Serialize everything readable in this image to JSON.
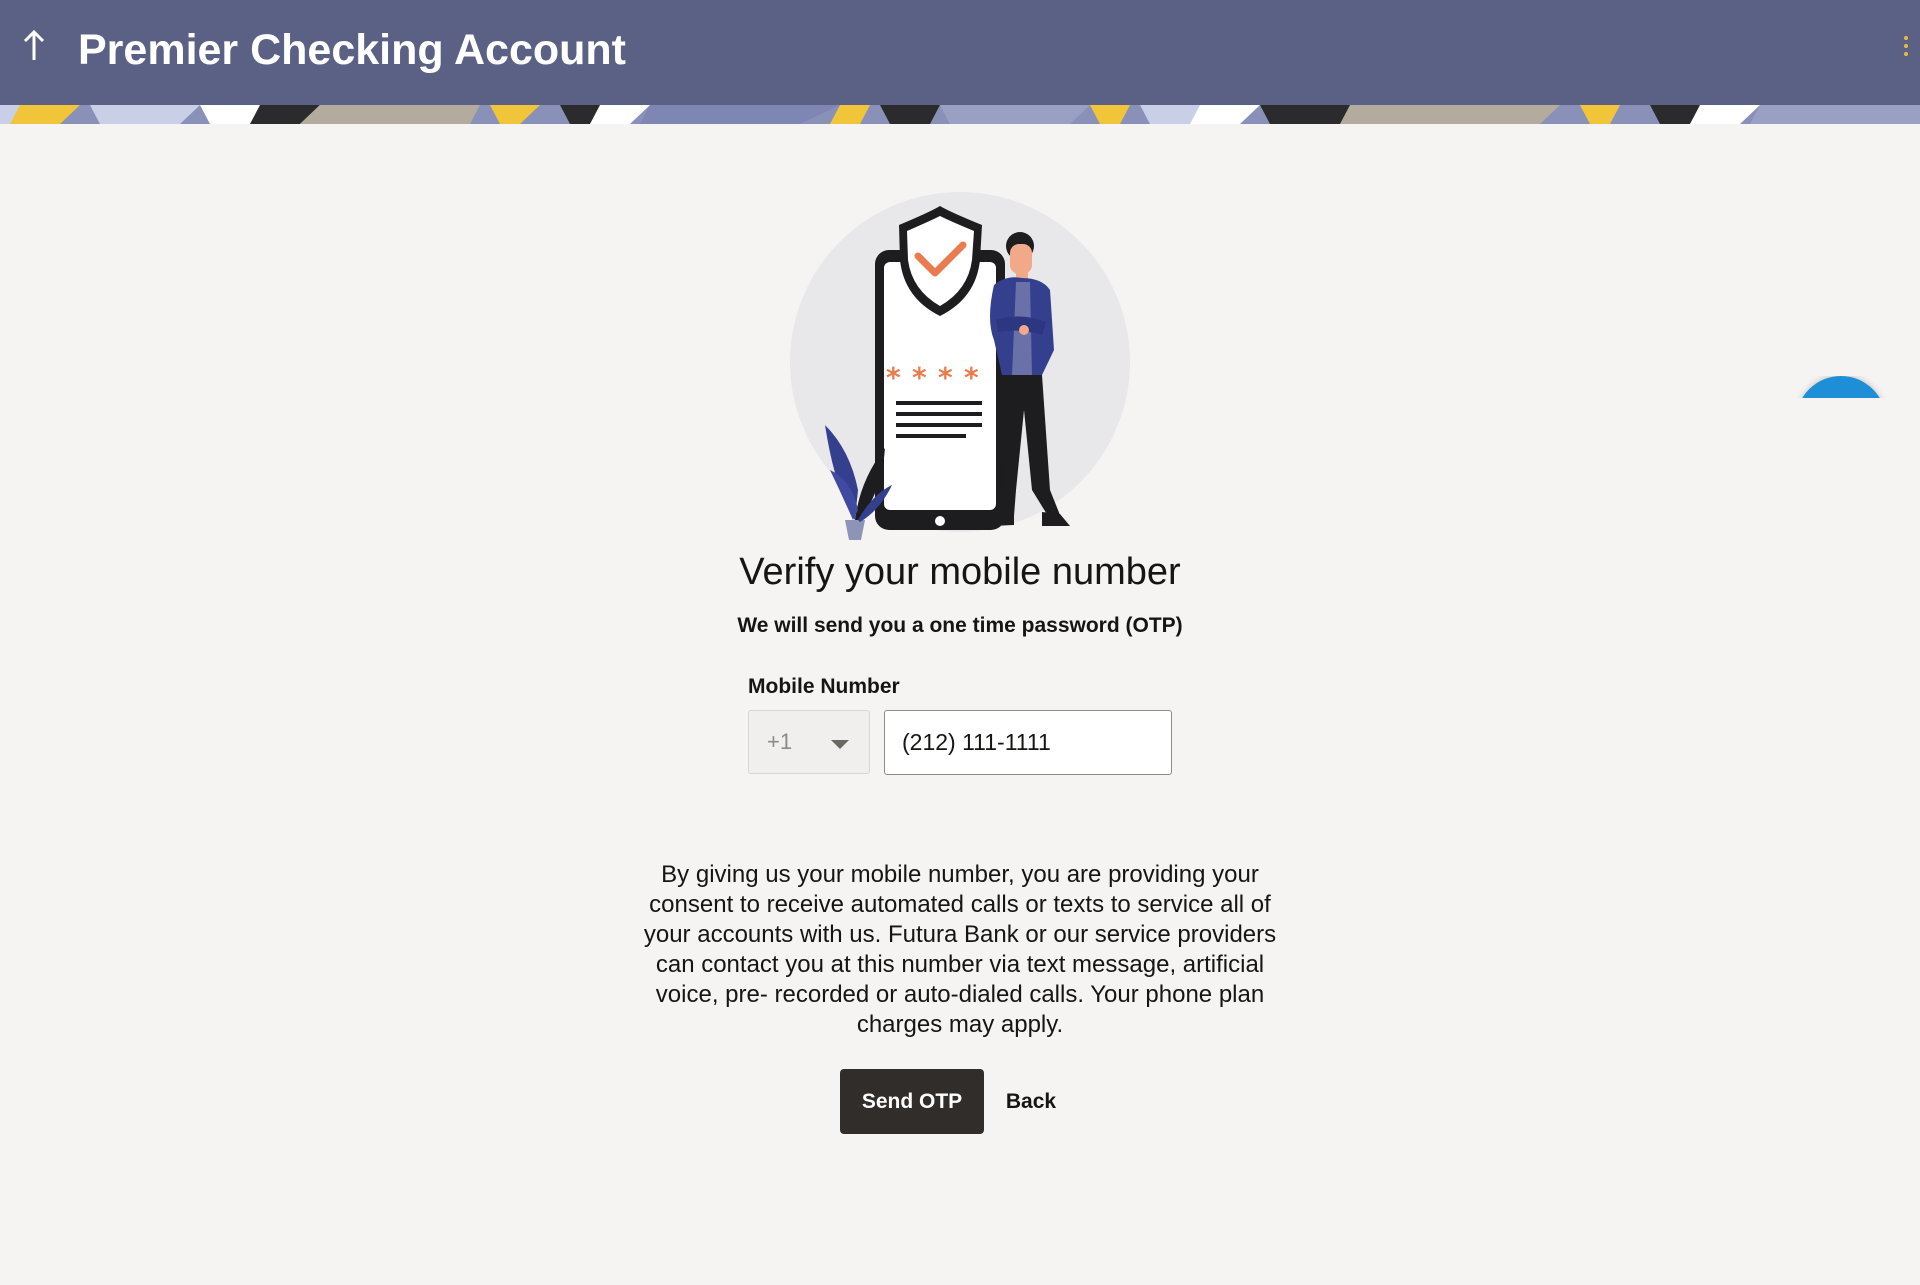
{
  "header": {
    "title": "Premier Checking Account",
    "back_icon": "arrow-up-icon",
    "menu_icon": "kebab-menu-icon",
    "band_colors": [
      "#f0c53a",
      "#2b2b2d",
      "#c9cfe6",
      "#b4ab9f",
      "#7e87b4",
      "#ffffff"
    ]
  },
  "main": {
    "illustration": "phone-security-illustration",
    "heading": "Verify your mobile number",
    "subheading": "We will send you a one time password (OTP)",
    "mobile_label": "Mobile Number",
    "country_code": "+1",
    "mobile_value": "(212) 111-1111",
    "consent": "By giving us your mobile number, you are providing your consent to receive automated calls or texts to service all of your accounts with us. Futura Bank or our service providers can contact you at this number via text message, artificial voice, pre- recorded or auto-dialed calls. Your phone plan charges may apply.",
    "send_otp_label": "Send OTP",
    "back_label": "Back"
  },
  "help_button": {
    "color": "#1e8fd6"
  },
  "colors": {
    "header_bg": "#5b6184",
    "page_bg": "#f5f4f2",
    "primary_button": "#312d2a",
    "accent_orange": "#e97b4f",
    "illustration_blue": "#343f8e"
  }
}
